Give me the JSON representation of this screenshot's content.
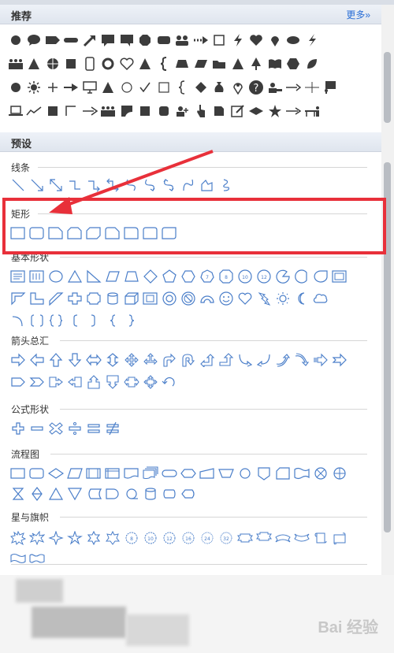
{
  "recommended": {
    "title": "推荐",
    "more": "更多»"
  },
  "presets": {
    "title": "预设"
  },
  "categories": {
    "lines": "线条",
    "rectangles": "矩形",
    "basic": "基本形状",
    "arrows": "箭头总汇",
    "formula": "公式形状",
    "flowchart": "流程图",
    "stars": "星与旗帜"
  },
  "watermark": "Bai 经验",
  "colors": {
    "accent": "#2b6fd6",
    "highlight": "#e8303a",
    "icon_gray": "#3c3c3c",
    "icon_blue": "#4a7ec9"
  }
}
